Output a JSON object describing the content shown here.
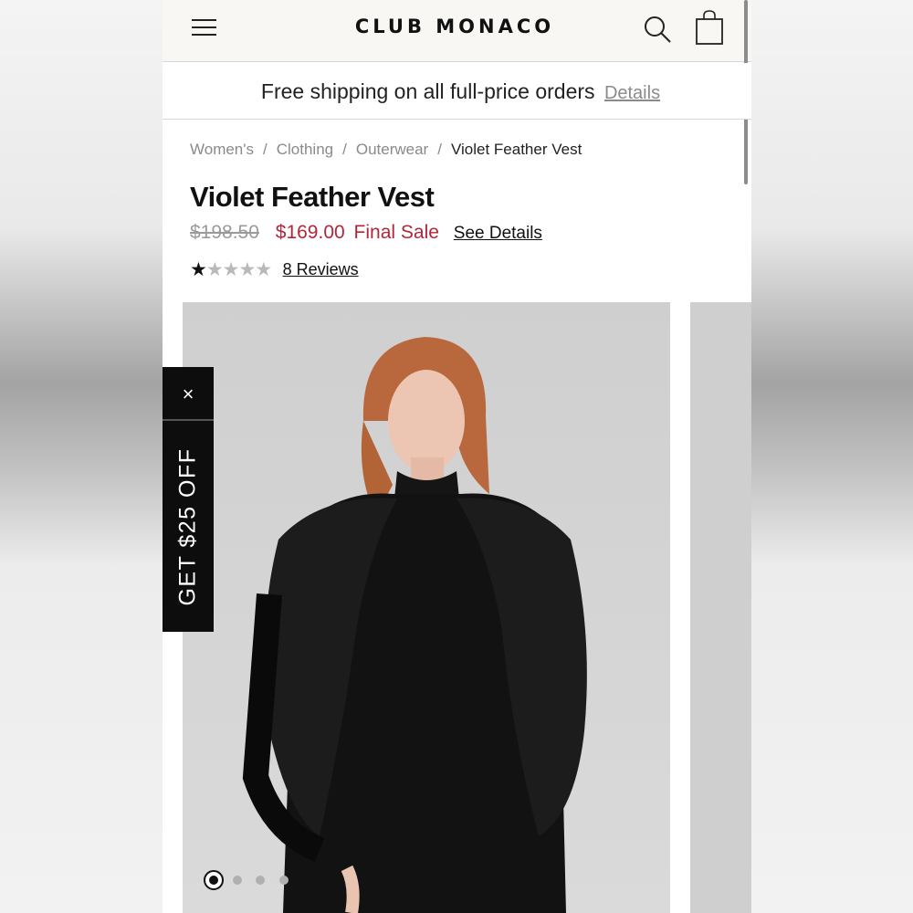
{
  "header": {
    "brand": "CLUB MONACO",
    "menu_icon": "hamburger-menu-icon",
    "search_icon": "search-icon",
    "bag_icon": "shopping-bag-icon"
  },
  "promo_banner": {
    "text": "Free shipping on all full-price orders",
    "link_label": "Details"
  },
  "breadcrumb": {
    "items": [
      "Women's",
      "Clothing",
      "Outerwear",
      "Violet Feather Vest"
    ],
    "separator": "/"
  },
  "product": {
    "title": "Violet Feather Vest",
    "original_price": "$198.50",
    "sale_price": "$169.00",
    "sale_label": "Final Sale",
    "details_link": "See Details",
    "rating": 1,
    "rating_max": 5,
    "reviews_label": "8 Reviews"
  },
  "gallery": {
    "image_count": 4,
    "active_index": 0
  },
  "discount_tab": {
    "close_label": "×",
    "text": "GET $25 OFF"
  },
  "colors": {
    "sale": "#b3263a",
    "header_bg": "#f8f7f4",
    "tab_bg": "#0d0d0d"
  }
}
